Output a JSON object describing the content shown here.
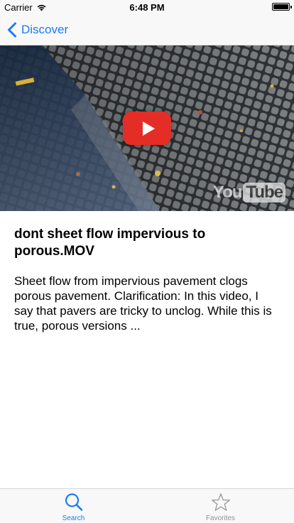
{
  "status_bar": {
    "carrier": "Carrier",
    "time": "6:48 PM",
    "battery_level": 1.0
  },
  "nav": {
    "back_label": "Discover",
    "accent_color": "#1a7cf5"
  },
  "video": {
    "watermark_you": "You",
    "watermark_tube": "Tube",
    "play_button_color": "#e52d27"
  },
  "content": {
    "title": "dont sheet flow impervious to porous.MOV",
    "description": "Sheet flow from impervious pavement clogs porous pavement. Clarification: In this video, I say that pavers are tricky to unclog. While this is true, porous versions ..."
  },
  "tab_bar": {
    "tabs": [
      {
        "label": "Search",
        "icon": "search-icon",
        "selected": true
      },
      {
        "label": "Favorites",
        "icon": "star-icon",
        "selected": false
      }
    ]
  }
}
